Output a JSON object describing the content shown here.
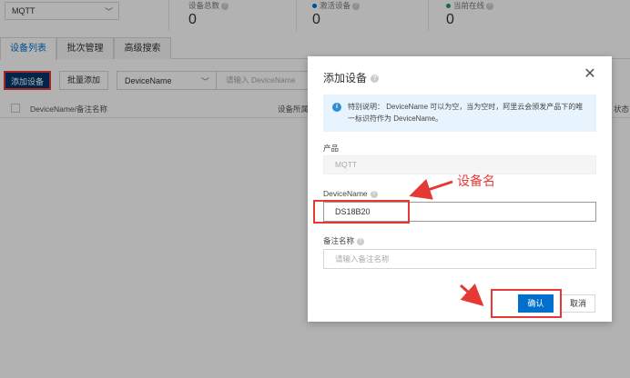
{
  "stats": {
    "product_value": "MQTT",
    "total_label": "设备总数",
    "total_value": "0",
    "active_label": "激活设备",
    "active_value": "0",
    "active_color": "#0070cc",
    "online_label": "当前在线",
    "online_value": "0",
    "online_color": "#1e9e57"
  },
  "tabs": [
    "设备列表",
    "批次管理",
    "高级搜索"
  ],
  "toolbar": {
    "add_label": "添加设备",
    "batch_label": "批量添加",
    "field_value": "DeviceName",
    "search_placeholder": "请输入 DeviceName"
  },
  "table": {
    "col_name": "DeviceName/备注名称",
    "col_product": "设备所属",
    "col_status": "状态"
  },
  "modal": {
    "title": "添加设备",
    "notice": "特别说明：  DeviceName 可以为空，当为空时，阿里云会颁发产品下的唯一标识符作为 DeviceName。",
    "product_label": "产品",
    "product_value": "MQTT",
    "name_label": "DeviceName",
    "name_value": "DS18B20",
    "alias_label": "备注名称",
    "alias_placeholder": "请输入备注名称",
    "ok_label": "确认",
    "cancel_label": "取消"
  },
  "annotation": {
    "text": "设备名",
    "color": "#e53935"
  }
}
